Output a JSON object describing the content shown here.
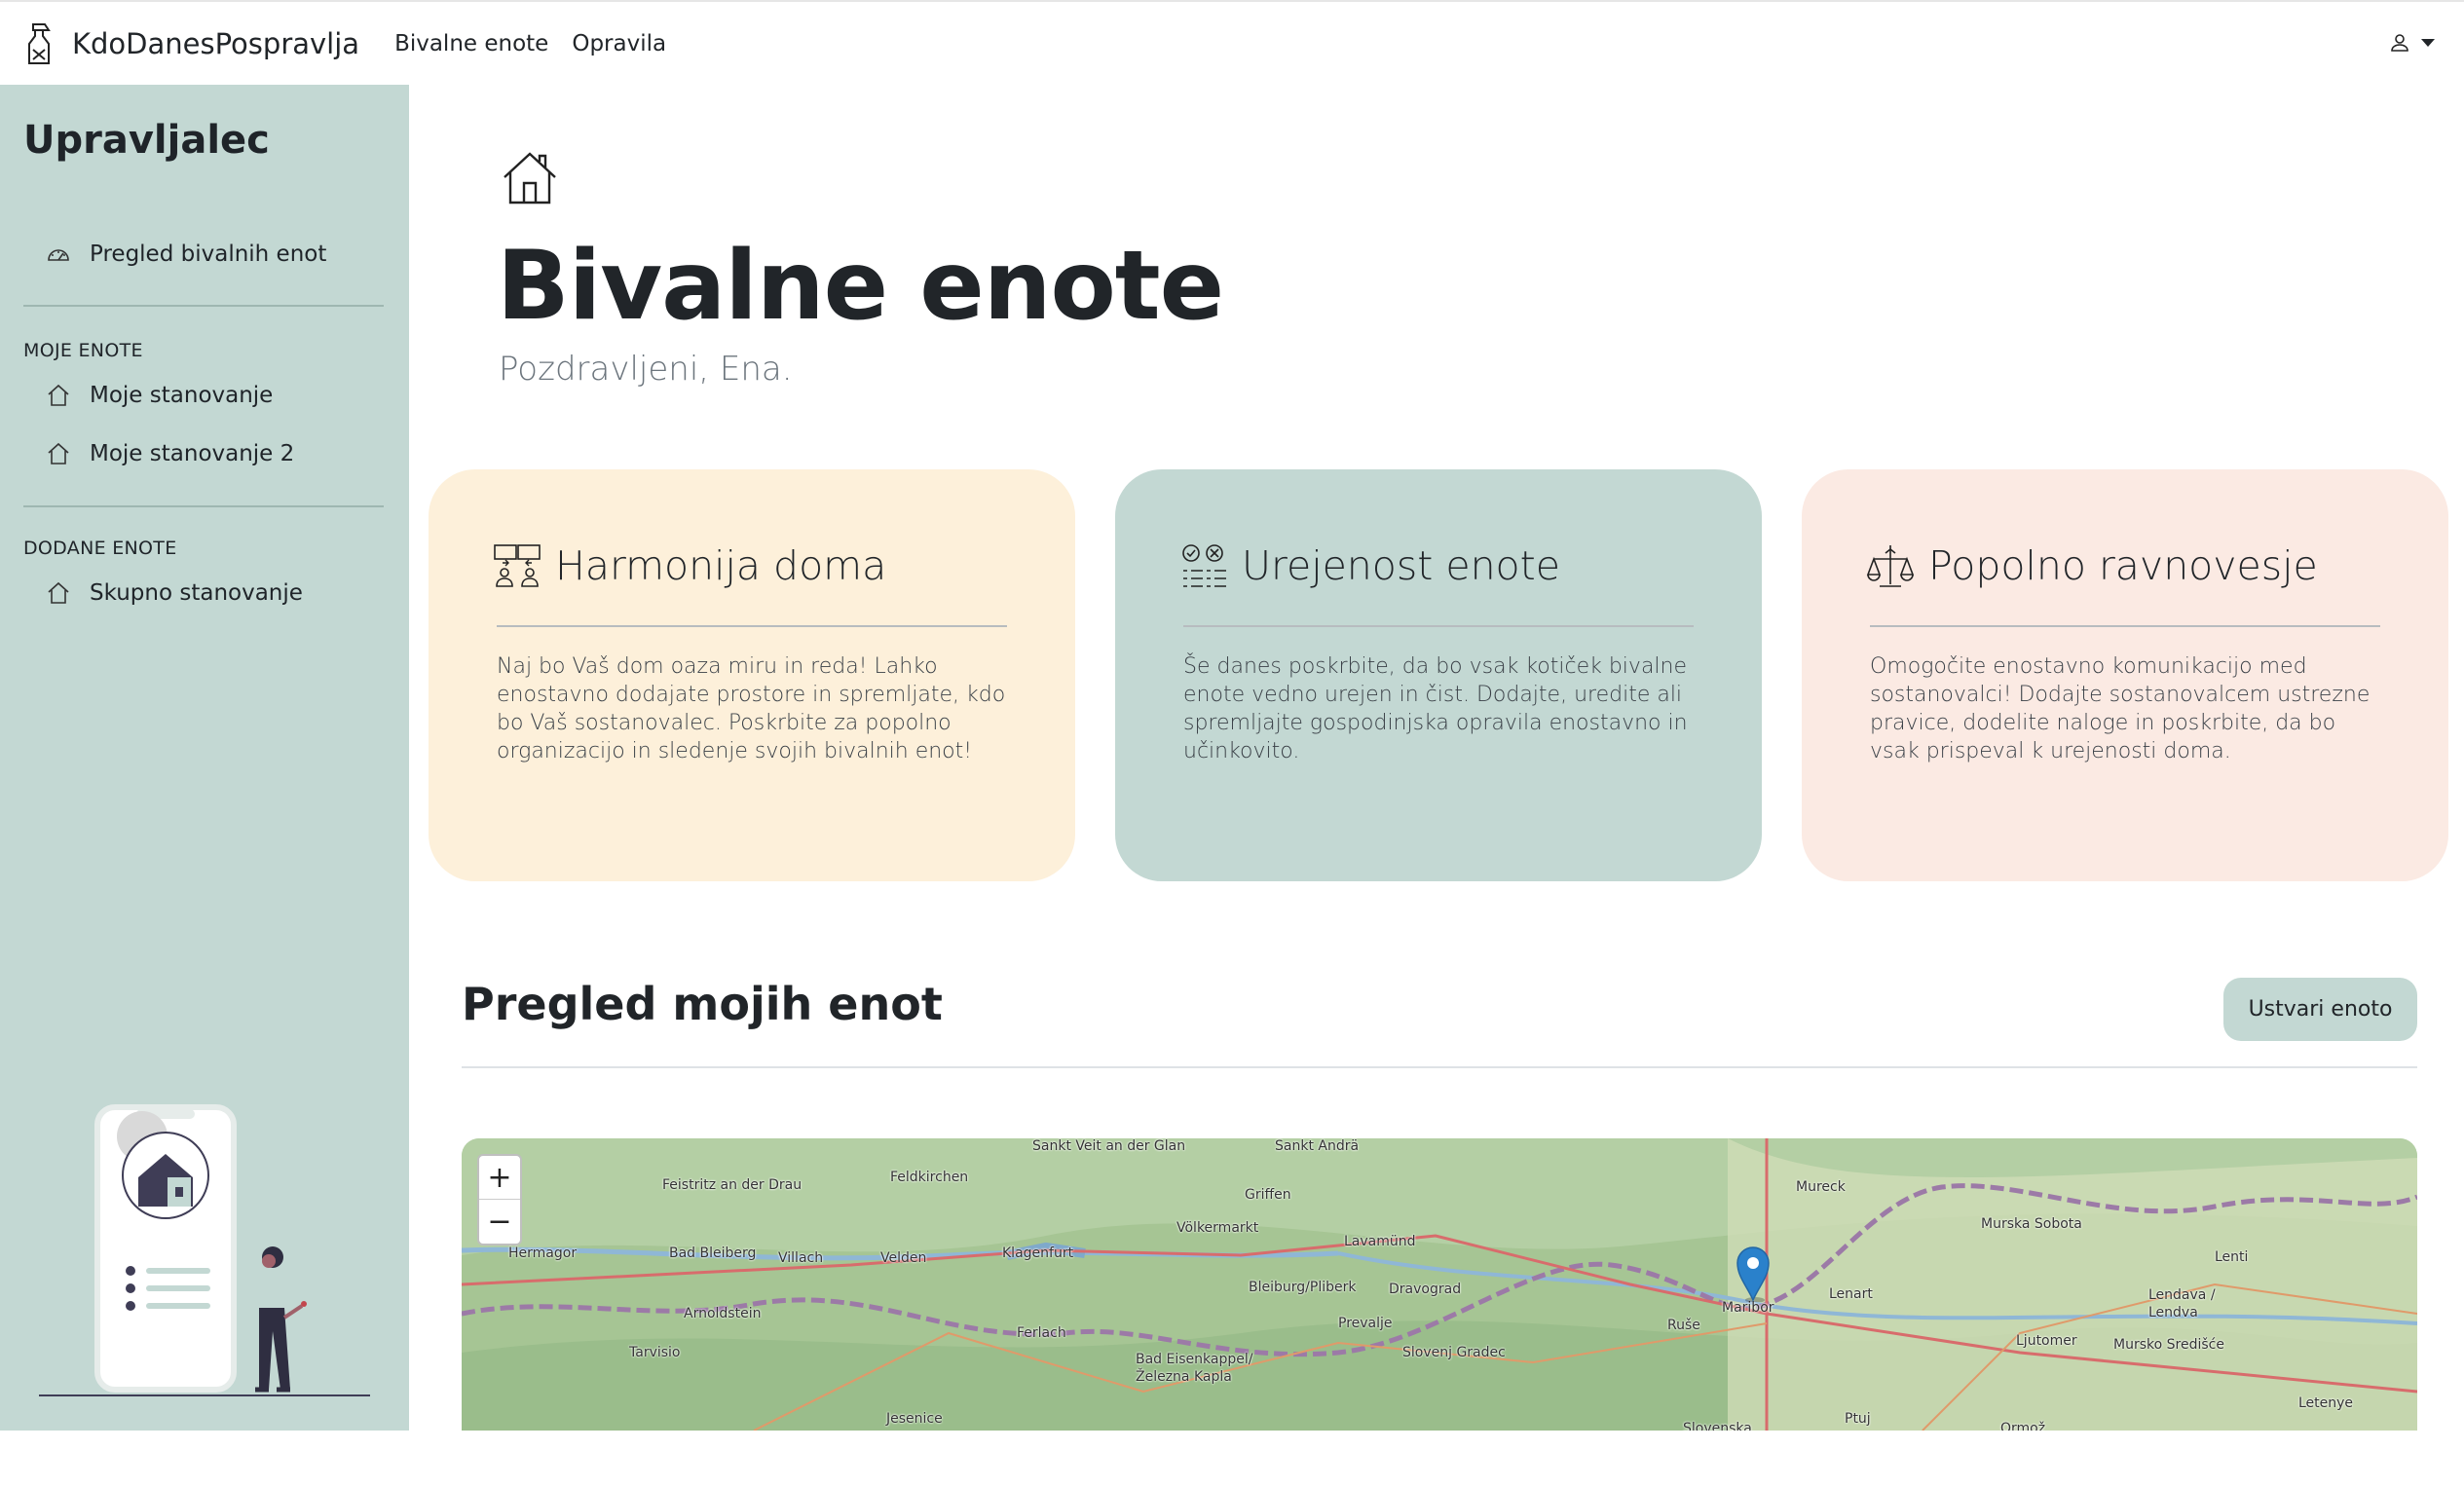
{
  "navbar": {
    "brand": "KdoDanesPospravlja",
    "links": [
      "Bivalne enote",
      "Opravila"
    ]
  },
  "sidebar": {
    "title": "Upravljalec",
    "overview": "Pregled bivalnih enot",
    "my_units_heading": "MOJE ENOTE",
    "my_units": [
      "Moje stanovanje",
      "Moje stanovanje 2"
    ],
    "added_units_heading": "DODANE ENOTE",
    "added_units": [
      "Skupno stanovanje"
    ]
  },
  "header": {
    "title": "Bivalne enote",
    "greeting": "Pozdravljeni, Ena."
  },
  "cards": [
    {
      "title": "Harmonija doma",
      "icon": "people-exchange-icon",
      "text": "Naj bo Vaš dom oaza miru in reda! Lahko enostavno dodajate prostore in spremljate, kdo bo Vaš sostanovalec. Poskrbite za popolno organizacijo in sledenje svojih bivalnih enot!",
      "color": "#fdf0da"
    },
    {
      "title": "Urejenost enote",
      "icon": "checklist-icon",
      "text": "Še danes poskrbite, da bo vsak kotiček bivalne enote vedno urejen in čist. Dodajte, uredite ali spremljajte gospodinjska opravila enostavno in učinkovito.",
      "color": "#c3d8d3"
    },
    {
      "title": "Popolno ravnovesje",
      "icon": "balance-scale-icon",
      "text": "Omogočite enostavno komunikacijo med sostanovalci! Dodajte sostanovalcem ustrezne pravice, dodelite naloge in poskrbite, da bo vsak prispeval k urejenosti doma.",
      "color": "#fbeae3"
    }
  ],
  "overview": {
    "title": "Pregled mojih enot",
    "create_button": "Ustvari enoto"
  },
  "map": {
    "zoom_in": "+",
    "zoom_out": "−",
    "places": [
      "Sankt Veit an der Glan",
      "Sankt Andrä",
      "Feistritz an der Drau",
      "Feldkirchen",
      "Griffen",
      "Völkermarkt",
      "Hermagor",
      "Bad Bleiberg",
      "Villach",
      "Velden",
      "Klagenfurt",
      "Lavamünd",
      "Bleiburg/Pliberk",
      "Dravograd",
      "Arnoldstein",
      "Ferlach",
      "Prevalje",
      "Tarvisio",
      "Bad Eisenkappel/ Železna Kapla",
      "Slovenj Gradec",
      "Jesenice",
      "Mureck",
      "Murska Sobota",
      "Lenti",
      "Lenart",
      "Maribor",
      "Ruše",
      "Lendava / Lendva",
      "Ljutomer",
      "Mursko Središće",
      "Letenye",
      "Ptuj",
      "Ormož",
      "Slovenska"
    ],
    "marker": "Maribor"
  },
  "colors": {
    "sidebar": "#c3d8d3",
    "card_yellow": "#fdf0da",
    "card_green": "#c3d8d3",
    "card_pink": "#fbeae3"
  }
}
